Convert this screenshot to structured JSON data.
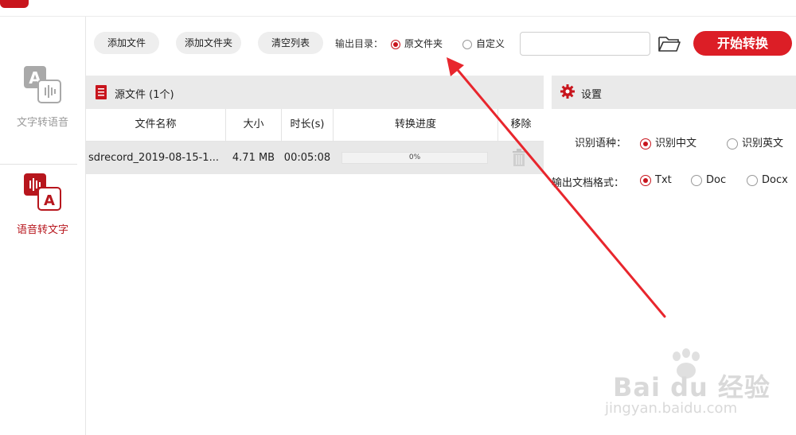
{
  "sidebar": {
    "items": [
      {
        "label": "文字转语音",
        "active": false,
        "icon": "text-to-speech-icon"
      },
      {
        "label": "语音转文字",
        "active": true,
        "icon": "speech-to-text-icon"
      }
    ]
  },
  "toolbar": {
    "add_file": "添加文件",
    "add_folder": "添加文件夹",
    "clear_list": "清空列表",
    "output_label": "输出目录：",
    "output_options": [
      {
        "label": "原文件夹",
        "selected": true
      },
      {
        "label": "自定义",
        "selected": false
      }
    ],
    "path_value": "",
    "folder_icon": "folder-open-icon",
    "start_button": "开始转换"
  },
  "source": {
    "title": "源文件 (1个)",
    "columns": [
      "文件名称",
      "大小",
      "时长(s)",
      "转换进度",
      "移除"
    ],
    "rows": [
      {
        "name": "sdrecord_2019-08-15-1...",
        "size": "4.71 MB",
        "duration": "00:05:08",
        "progress": 0,
        "progress_text": "0%"
      }
    ]
  },
  "settings": {
    "title": "设置",
    "language_label": "识别语种：",
    "language_options": [
      {
        "label": "识别中文",
        "selected": true
      },
      {
        "label": "识别英文",
        "selected": false
      }
    ],
    "format_label": "输出文档格式：",
    "format_options": [
      {
        "label": "Txt",
        "selected": true
      },
      {
        "label": "Doc",
        "selected": false
      },
      {
        "label": "Docx",
        "selected": false
      }
    ]
  },
  "watermark": {
    "main": "Bai du 经验",
    "sub": "jingyan.baidu.com"
  },
  "colors": {
    "accent": "#dc1e26",
    "sidebar_active": "#b7161d",
    "annotation_arrow": "#e8262d"
  }
}
